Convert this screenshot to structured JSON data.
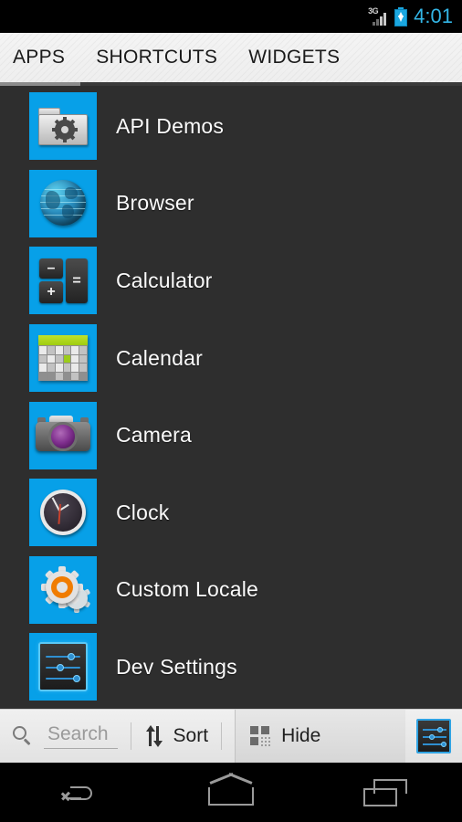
{
  "status_bar": {
    "network_label": "3G",
    "time": "4:01",
    "time_color": "#33b5e5",
    "battery_state": "charging",
    "signal_bars": 4,
    "signal_active_bars": 2
  },
  "tabs": {
    "items": [
      {
        "label": "APPS",
        "selected": true
      },
      {
        "label": "SHORTCUTS",
        "selected": false
      },
      {
        "label": "WIDGETS",
        "selected": false
      }
    ],
    "indicator_color": "#8b8b8b"
  },
  "app_list": {
    "icon_background": "#07a0e8",
    "list_background": "#2e2e2e",
    "items": [
      {
        "label": "API Demos",
        "icon": "folder-gear-icon"
      },
      {
        "label": "Browser",
        "icon": "globe-icon"
      },
      {
        "label": "Calculator",
        "icon": "calculator-icon"
      },
      {
        "label": "Calendar",
        "icon": "calendar-icon"
      },
      {
        "label": "Camera",
        "icon": "camera-icon"
      },
      {
        "label": "Clock",
        "icon": "analog-clock-icon"
      },
      {
        "label": "Custom Locale",
        "icon": "gears-icon"
      },
      {
        "label": "Dev Settings",
        "icon": "sliders-icon"
      }
    ]
  },
  "calculator_icon": {
    "keys": [
      "–",
      "+",
      "="
    ]
  },
  "action_bar": {
    "search": {
      "placeholder": "Search",
      "value": "",
      "icon": "search-icon"
    },
    "sort": {
      "label": "Sort",
      "icon": "sort-arrows-icon"
    },
    "hide": {
      "label": "Hide",
      "icon": "grid-squares-icon"
    },
    "settings": {
      "icon": "sliders-icon"
    }
  },
  "nav_bar": {
    "back": "back-icon",
    "home": "home-icon",
    "recents": "recents-icon"
  }
}
